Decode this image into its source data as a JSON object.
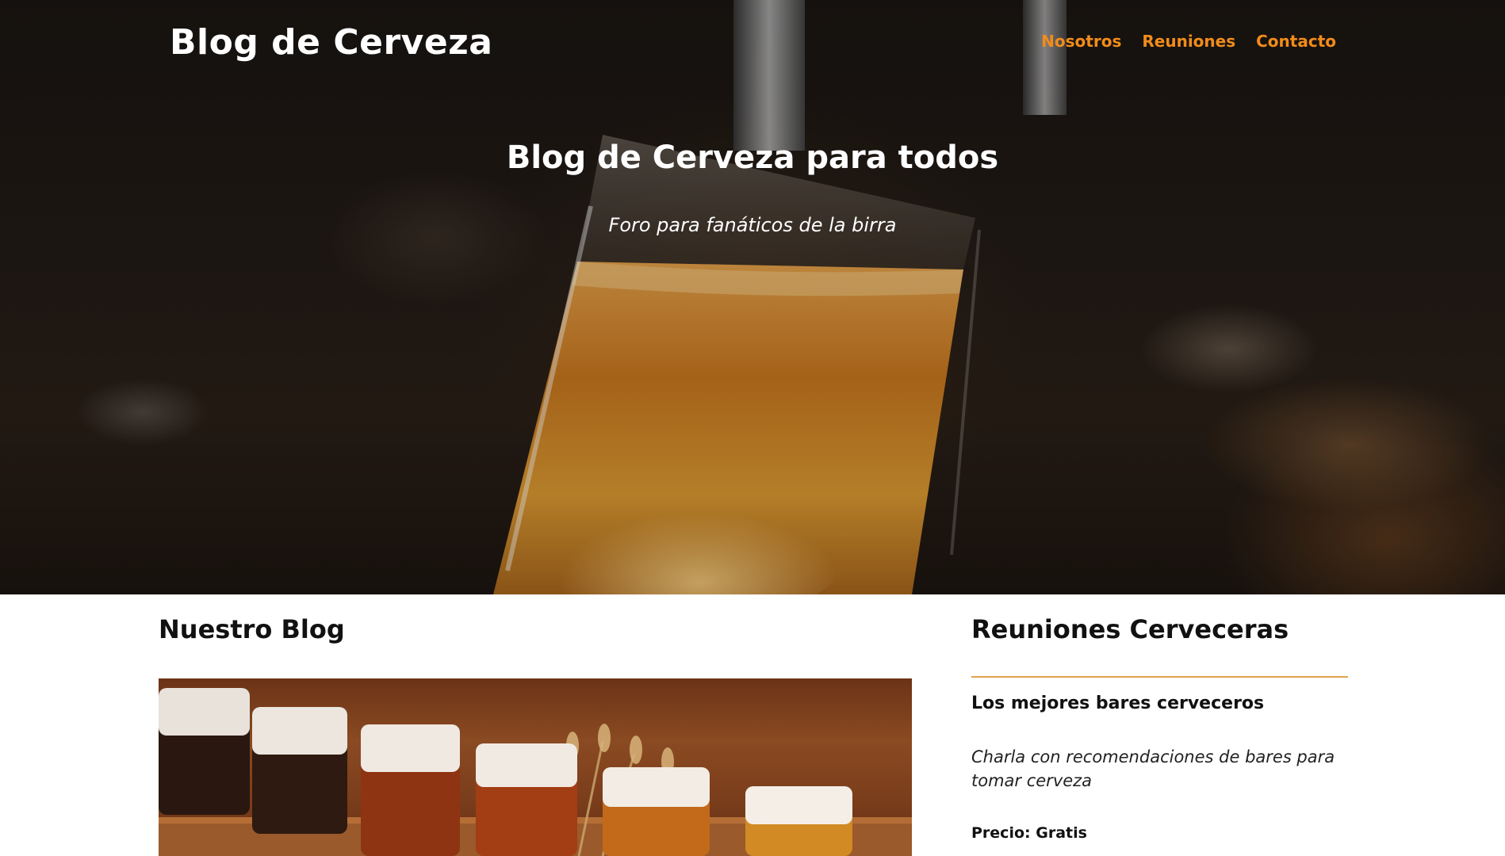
{
  "header": {
    "site_title": "Blog de Cerveza",
    "nav": [
      {
        "label": "Nosotros"
      },
      {
        "label": "Reuniones"
      },
      {
        "label": "Contacto"
      }
    ]
  },
  "hero": {
    "heading": "Blog de Cerveza para todos",
    "subtitle": "Foro para fanáticos de la birra"
  },
  "blog": {
    "heading": "Nuestro Blog"
  },
  "sidebar": {
    "heading": "Reuniones Cerveceras",
    "event": {
      "title": "Los mejores bares cerveceros",
      "description": "Charla con recomendaciones de bares para tomar cerveza",
      "price": "Precio: Gratis"
    }
  },
  "colors": {
    "nav_link": "#f28c1a",
    "divider": "#e0a44a",
    "text": "#111111"
  }
}
